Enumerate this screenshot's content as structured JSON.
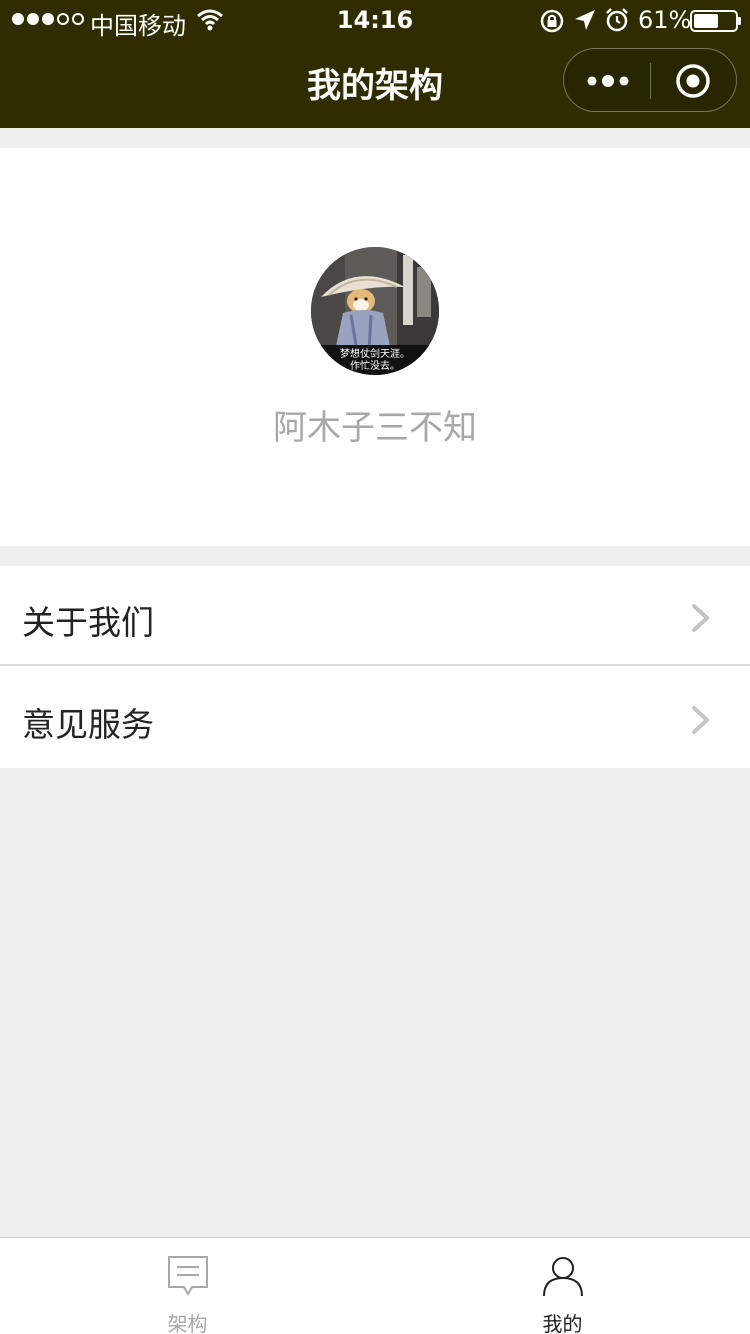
{
  "status_bar": {
    "carrier": "中国移动",
    "time": "14:16",
    "battery": "61%",
    "signal_strength": 3,
    "signal_total": 5,
    "battery_level": 0.61
  },
  "nav": {
    "title": "我的架构",
    "capsule_more_icon": "more-dots-icon",
    "capsule_close_icon": "close-target-icon"
  },
  "profile": {
    "nickname": "阿木子三不知",
    "avatar_caption_line1": "梦想仗剑天涯。",
    "avatar_caption_line2": "作忙没去。"
  },
  "menu": {
    "items": [
      {
        "label": "关于我们",
        "icon": "chevron-right-icon"
      },
      {
        "label": "意见服务",
        "icon": "chevron-right-icon"
      }
    ]
  },
  "tabbar": {
    "tabs": [
      {
        "label": "架构",
        "icon": "message-icon",
        "active": false
      },
      {
        "label": "我的",
        "icon": "user-icon",
        "active": true
      }
    ]
  },
  "colors": {
    "nav_bg": "#2f2d00",
    "page_bg": "#f0f0f0",
    "inactive_text": "#a8a8a8",
    "active_text": "#222222"
  }
}
